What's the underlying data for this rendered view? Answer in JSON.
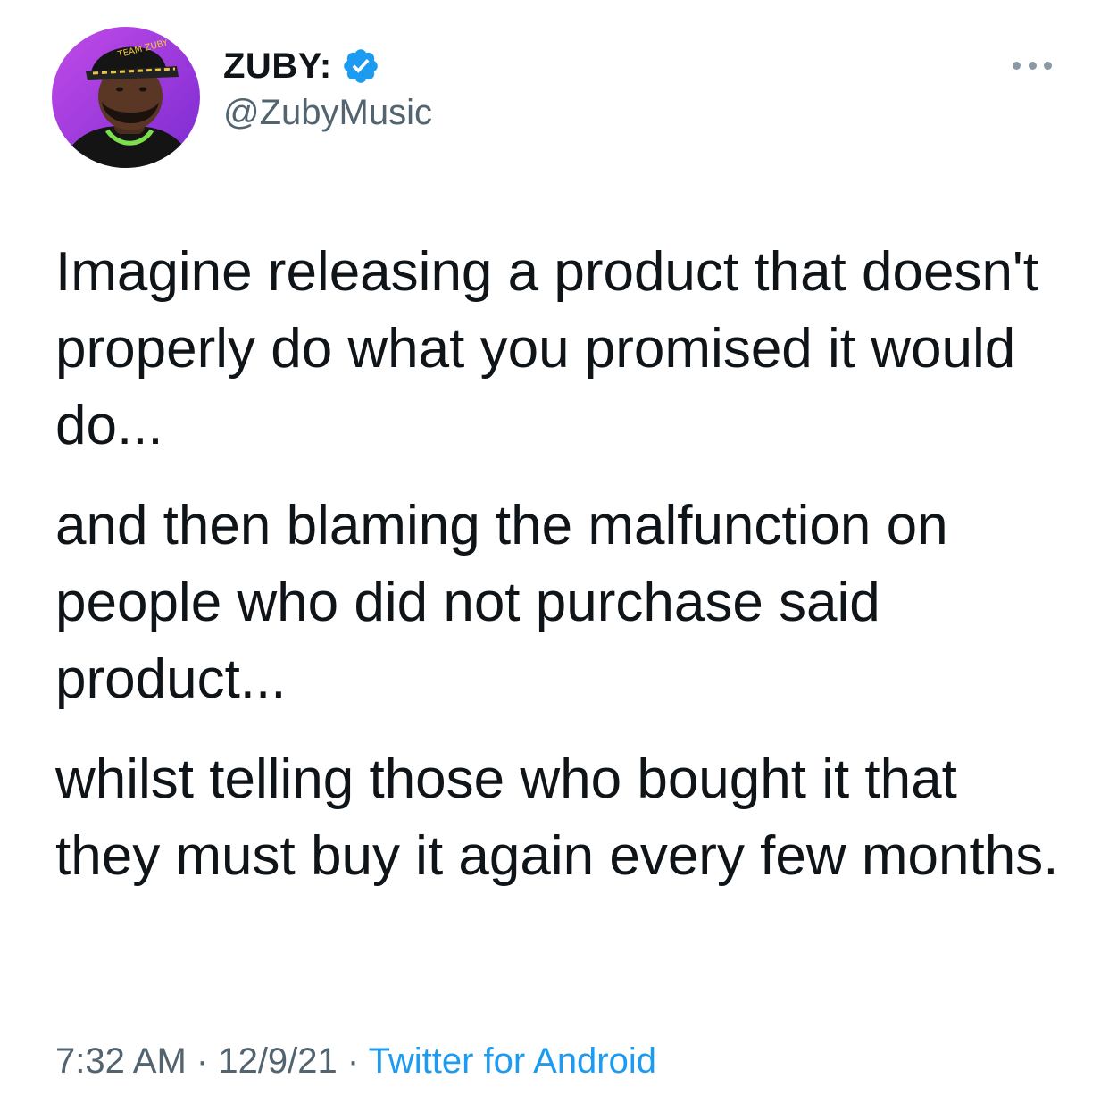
{
  "author": {
    "display_name": "ZUBY:",
    "handle": "@ZubyMusic",
    "verified_icon": "verified-badge-icon",
    "avatar_icon": "profile-avatar-image",
    "cap_text": "TEAM ZUBY"
  },
  "menu": {
    "icon": "more-options-icon"
  },
  "tweet": {
    "paragraphs": [
      "Imagine releasing a product that doesn't properly do what you promised it would do...",
      "and then blaming the malfunction on people who did not purchase said product...",
      "whilst telling those who bought it that they must buy it again every few months."
    ]
  },
  "meta": {
    "time": "7:32 AM",
    "separator": "·",
    "date": "12/9/21",
    "source": "Twitter for Android"
  },
  "colors": {
    "text": "#0f1419",
    "secondary": "#536471",
    "accent": "#1d9bf0",
    "avatar_background": "#a23be0"
  }
}
